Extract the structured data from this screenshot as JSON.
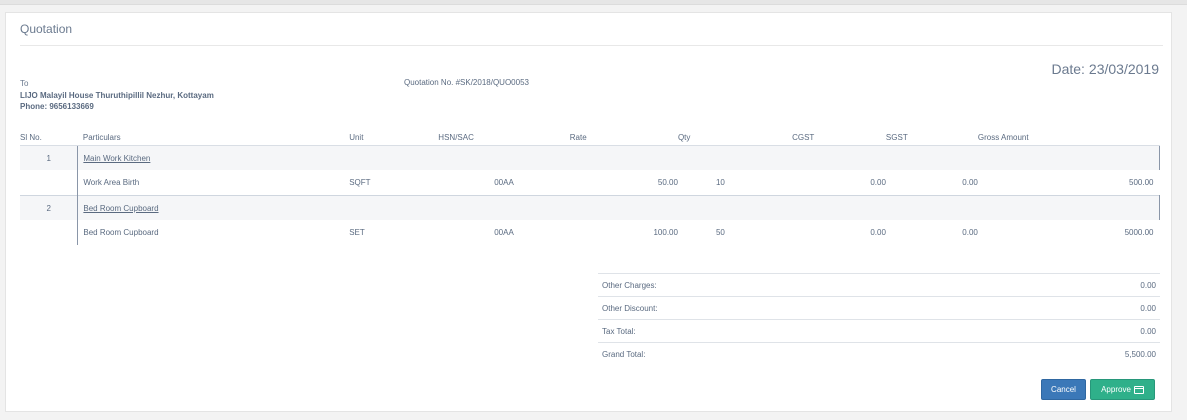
{
  "panel": {
    "title": "Quotation"
  },
  "customer": {
    "to_label": "To",
    "name_address": "LIJO Malayil House Thuruthipillil Nezhur, Kottayam",
    "phone": "Phone: 9656133669"
  },
  "quotation": {
    "number": "Quotation No. #SK/2018/QUO0053"
  },
  "date": {
    "label": "Date:",
    "value": "23/03/2019"
  },
  "table": {
    "headers": [
      "Sl No.",
      "Particulars",
      "Unit",
      "HSN/SAC",
      "Rate",
      "Qty",
      "CGST",
      "SGST",
      "Gross Amount"
    ],
    "groups": [
      {
        "sl": "1",
        "title": "Main Work Kitchen",
        "item": {
          "particulars": "Work Area Birth",
          "unit": "SQFT",
          "hsn": "00AA",
          "rate": "50.00",
          "qty": "10",
          "cgst": "0.00",
          "sgst": "0.00",
          "gross": "500.00"
        }
      },
      {
        "sl": "2",
        "title": "Bed Room Cupboard",
        "item": {
          "particulars": "Bed Room Cupboard",
          "unit": "SET",
          "hsn": "00AA",
          "rate": "100.00",
          "qty": "50",
          "cgst": "0.00",
          "sgst": "0.00",
          "gross": "5000.00"
        }
      }
    ]
  },
  "totals": [
    {
      "label": "Other Charges:",
      "value": "0.00"
    },
    {
      "label": "Other Discount:",
      "value": "0.00"
    },
    {
      "label": "Tax Total:",
      "value": "0.00"
    },
    {
      "label": "Grand Total:",
      "value": "5,500.00"
    }
  ],
  "actions": {
    "cancel_label": "Cancel",
    "approve_label": "Approve",
    "approve_icon": "credit-card-icon"
  },
  "colors": {
    "cancel": "#3b78b8",
    "approve": "#2fb08a"
  }
}
